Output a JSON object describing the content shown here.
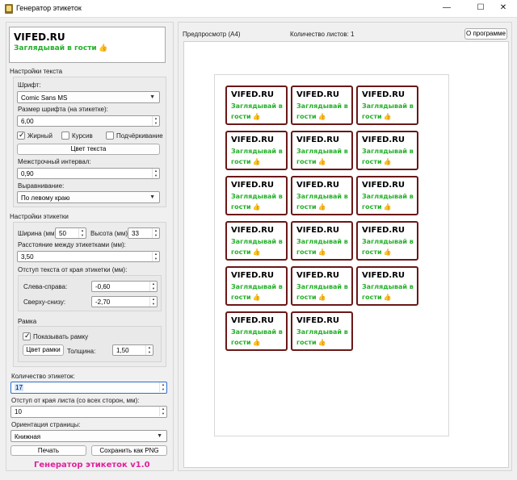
{
  "window": {
    "title": "Генератор этикеток",
    "minimize": "—",
    "maximize": "☐",
    "close": "✕"
  },
  "logo": {
    "title": "VIFED.RU",
    "tagline": "Заглядывай в гости",
    "emoji": "👍"
  },
  "text_settings": {
    "section": "Настройки текста",
    "font_label": "Шрифт:",
    "font_value": "Comic Sans MS",
    "font_size_label": "Размер шрифта (на этикетке):",
    "font_size_value": "6,00",
    "bold_label": "Жирный",
    "bold_checked": true,
    "italic_label": "Курсив",
    "italic_checked": false,
    "underline_label": "Подчёркивание",
    "underline_checked": false,
    "text_color_button": "Цвет текста",
    "line_spacing_label": "Межстрочный интервал:",
    "line_spacing_value": "0,90",
    "align_label": "Выравнивание:",
    "align_value": "По левому краю"
  },
  "label_settings": {
    "section": "Настройки этикетки",
    "width_label": "Ширина (мм):",
    "width_value": "50",
    "height_label": "Высота (мм):",
    "height_value": "33",
    "spacing_label": "Расстояние между этикетками (мм):",
    "spacing_value": "3,50",
    "indent_group": "Отступ текста от края этикетки (мм):",
    "lr_label": "Слева-справа:",
    "lr_value": "-0,60",
    "tb_label": "Сверху-снизу:",
    "tb_value": "-2,70",
    "frame_group": "Рамка",
    "show_frame_label": "Показывать рамку",
    "show_frame_checked": true,
    "frame_color_button": "Цвет рамки",
    "thickness_label": "Толщина:",
    "thickness_value": "1,50"
  },
  "count": {
    "label": "Количество этикеток:",
    "value": "17"
  },
  "margin": {
    "label": "Отступ от края листа (со всех сторон, мм):",
    "value": "10"
  },
  "orientation": {
    "label": "Ориентация страницы:",
    "value": "Книжная"
  },
  "actions": {
    "print": "Печать",
    "save_png": "Сохранить как PNG"
  },
  "footer": {
    "title": "Генератор этикеток v1.0"
  },
  "preview": {
    "title": "Предпросмотр (A4)",
    "sheets": "Количество листов: 1",
    "about_button": "О программе",
    "label_count": 17,
    "columns": 3,
    "card_line1": "VIFED.RU",
    "card_line2": "Заглядывай в",
    "card_line3": "гости",
    "card_emoji": "👍",
    "frame_color": "#6b1717",
    "text_color": "#25b02a"
  }
}
